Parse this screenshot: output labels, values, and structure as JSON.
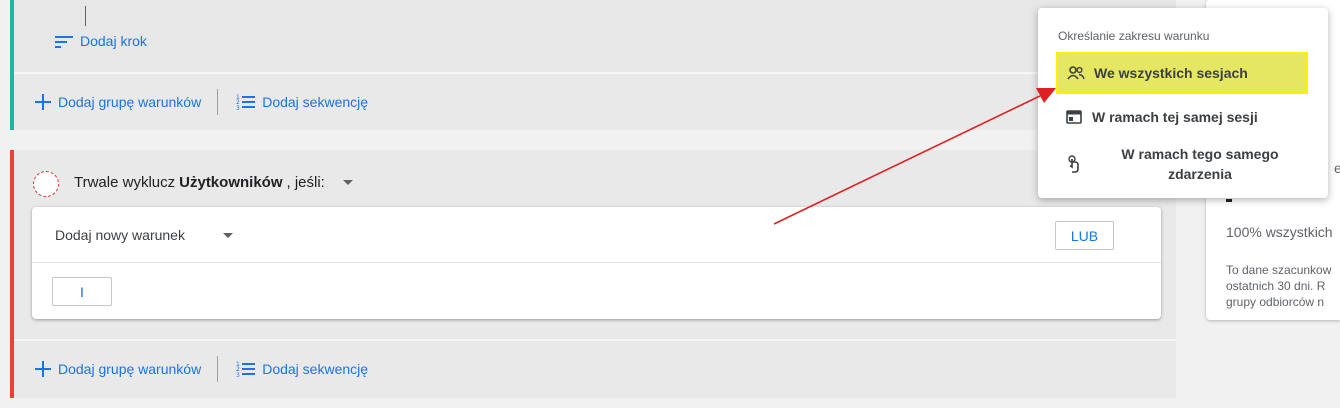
{
  "section_include": {
    "add_step": "Dodaj krok",
    "add_group": "Dodaj grupę warunków",
    "add_sequence": "Dodaj sekwencję"
  },
  "section_exclude": {
    "header_prefix": "Trwale wyklucz",
    "header_bold": "Użytkowników",
    "header_suffix": ", jeśli:",
    "condition_placeholder": "Dodaj nowy warunek",
    "or_button": "LUB",
    "and_button": "I",
    "add_group": "Dodaj grupę warunków",
    "add_sequence": "Dodaj sekwencję"
  },
  "scope_menu": {
    "title": "Określanie zakresu warunku",
    "items": [
      {
        "label": "We wszystkich sesjach",
        "icon": "people-icon",
        "selected": true
      },
      {
        "label": "W ramach tej samej sesji",
        "icon": "browser-window-icon",
        "selected": false
      },
      {
        "label": "W ramach tego samego zdarzenia",
        "icon": "touch-icon",
        "selected": false
      }
    ]
  },
  "right_panel": {
    "heading_fragment": "eg",
    "count": "-",
    "percent_text": "100% wszystkich",
    "note_lines": [
      "To dane szacunkow",
      "ostatnich 30 dni. R",
      "grupy odbiorców n"
    ]
  },
  "colors": {
    "include_accent": "#1fb5a0",
    "exclude_accent": "#ea4335",
    "link": "#1a73e8",
    "highlight": "#e5e763",
    "arrow": "#e02020"
  }
}
